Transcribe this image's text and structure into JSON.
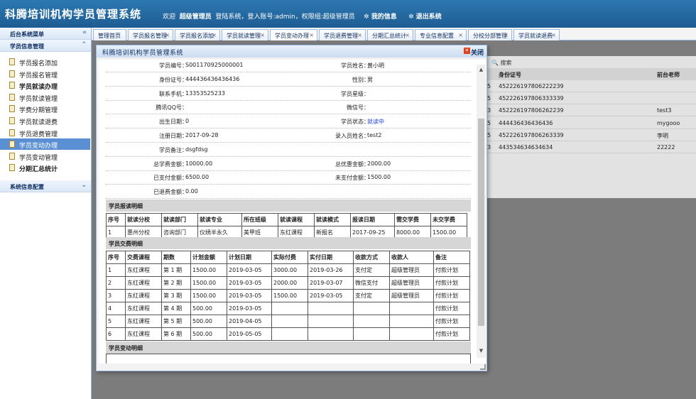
{
  "header": {
    "system_name": "科腾培训机构学员管理系统",
    "welcome_text": "欢迎",
    "user_name": "超级管理员",
    "login_info": "登陆系统，登入账号:admin，权限组:超级管理员",
    "my_info": "我的信息",
    "logout": "退出系统"
  },
  "sidebar": {
    "backend_menu_title": "后台系统菜单",
    "section1_title": "学员信息管理",
    "items": [
      {
        "label": "学员报名添加",
        "bold": false,
        "active": false
      },
      {
        "label": "学员报名管理",
        "bold": false,
        "active": false
      },
      {
        "label": "学员就读办理",
        "bold": true,
        "active": false
      },
      {
        "label": "学员就读管理",
        "bold": false,
        "active": false
      },
      {
        "label": "学费分期管理",
        "bold": false,
        "active": false
      },
      {
        "label": "学员就读退费",
        "bold": false,
        "active": false
      },
      {
        "label": "学员退费管理",
        "bold": false,
        "active": false
      },
      {
        "label": "学员变动办理",
        "bold": false,
        "active": true
      },
      {
        "label": "学员变动管理",
        "bold": false,
        "active": false
      },
      {
        "label": "分期汇总统计",
        "bold": true,
        "active": false
      }
    ],
    "section2_title": "系统信息配置"
  },
  "tabs": [
    {
      "label": "管理首页",
      "closable": false
    },
    {
      "label": "学员报名管理",
      "closable": true
    },
    {
      "label": "学员报名添加",
      "closable": true
    },
    {
      "label": "学员就读管理",
      "closable": true
    },
    {
      "label": "学员变动办理",
      "closable": true
    },
    {
      "label": "学员退费管理",
      "closable": true
    },
    {
      "label": "分期汇总统计",
      "closable": true
    },
    {
      "label": "专业信息配置",
      "closable": true
    },
    {
      "label": "分校分部管理",
      "closable": true
    },
    {
      "label": "学员就读退费",
      "closable": true
    }
  ],
  "background_table": {
    "search_label": "搜索",
    "col_id": "身份证号",
    "col_teacher": "前台老师",
    "rows": [
      {
        "prefix": "5",
        "id": "452226197806222239",
        "teacher": ""
      },
      {
        "prefix": "5",
        "id": "452226197806333339",
        "teacher": ""
      },
      {
        "prefix": "3",
        "id": "452226197806262239",
        "teacher": "test3"
      },
      {
        "prefix": "5",
        "id": "444436436436436",
        "teacher": "mygooo"
      },
      {
        "prefix": "5",
        "id": "452226197806263339",
        "teacher": "李明"
      },
      {
        "prefix": "3",
        "id": "443534634634634",
        "teacher": "22222"
      }
    ]
  },
  "dialog": {
    "title": "科腾培训机构学员管理系统",
    "close_label": "关闭",
    "info": [
      {
        "l_label": "学员编号：",
        "l_value": "S001170925000001",
        "r_label": "学员姓名：",
        "r_value": "黄小明"
      },
      {
        "l_label": "身份证号：",
        "l_value": "444436436436436",
        "r_label": "性别：",
        "r_value": "男"
      },
      {
        "l_label": "联系手机：",
        "l_value": "13353525233",
        "r_label": "学员星级：",
        "r_value": ""
      },
      {
        "l_label": "腾讯QQ号：",
        "l_value": "",
        "r_label": "微信号：",
        "r_value": ""
      },
      {
        "l_label": "出生日期：",
        "l_value": "0",
        "r_label": "学员状态：",
        "r_value": "就读中"
      },
      {
        "l_label": "注册日期：",
        "l_value": "2017-09-28",
        "r_label": "录入员姓名：",
        "r_value": "test2"
      },
      {
        "l_label": "学员备注：",
        "l_value": "dsgfdsg",
        "r_label": "",
        "r_value": ""
      },
      {
        "l_label": "总学费金额：",
        "l_value": "10000.00",
        "r_label": "总优惠金额：",
        "r_value": "2000.00"
      },
      {
        "l_label": "已支付金额：",
        "l_value": "6500.00",
        "r_label": "未支付金额：",
        "r_value": "1500.00"
      },
      {
        "l_label": "已退费金额：",
        "l_value": "0.00",
        "r_label": "",
        "r_value": ""
      }
    ],
    "status_color": "#1a3fd8",
    "enroll_section": "学员报读明细",
    "enroll_headers": [
      "序号",
      "就读分校",
      "就读部门",
      "就读专业",
      "所在班级",
      "就读课程",
      "就读模式",
      "报读日期",
      "需交学费",
      "未交学费"
    ],
    "enroll_rows": [
      [
        "1",
        "惠州分校",
        "咨询部门",
        "仪绣半永久",
        "美甲班",
        "东红课程",
        "新报名",
        "2017-09-25",
        "8000.00",
        "1500.00"
      ]
    ],
    "payment_section": "学员交费明细",
    "payment_headers": [
      "序号",
      "交费课程",
      "期数",
      "计划金额",
      "计划日期",
      "实际付费",
      "实付日期",
      "收款方式",
      "收款人",
      "备注"
    ],
    "payment_rows": [
      [
        "1",
        "东红课程",
        "第 1 期",
        "1500.00",
        "2019-03-05",
        "3000.00",
        "2019-03-26",
        "支付定",
        "超级管理员",
        "付款计划"
      ],
      [
        "2",
        "东红课程",
        "第 2 期",
        "1500.00",
        "2019-03-05",
        "2000.00",
        "2019-03-07",
        "微信支付",
        "超级管理员",
        "付款计划"
      ],
      [
        "3",
        "东红课程",
        "第 3 期",
        "1500.00",
        "2019-03-05",
        "1500.00",
        "2019-03-05",
        "支付定",
        "超级管理员",
        "付款计划"
      ],
      [
        "4",
        "东红课程",
        "第 4 期",
        "500.00",
        "2019-03-05",
        "",
        "",
        "",
        "",
        "付款计划"
      ],
      [
        "5",
        "东红课程",
        "第 5 期",
        "500.00",
        "2019-04-05",
        "",
        "",
        "",
        "",
        "付款计划"
      ],
      [
        "6",
        "东红课程",
        "第 6 期",
        "500.00",
        "2019-05-05",
        "",
        "",
        "",
        "",
        "付款计划"
      ]
    ],
    "change_section": "学员变动明细"
  }
}
